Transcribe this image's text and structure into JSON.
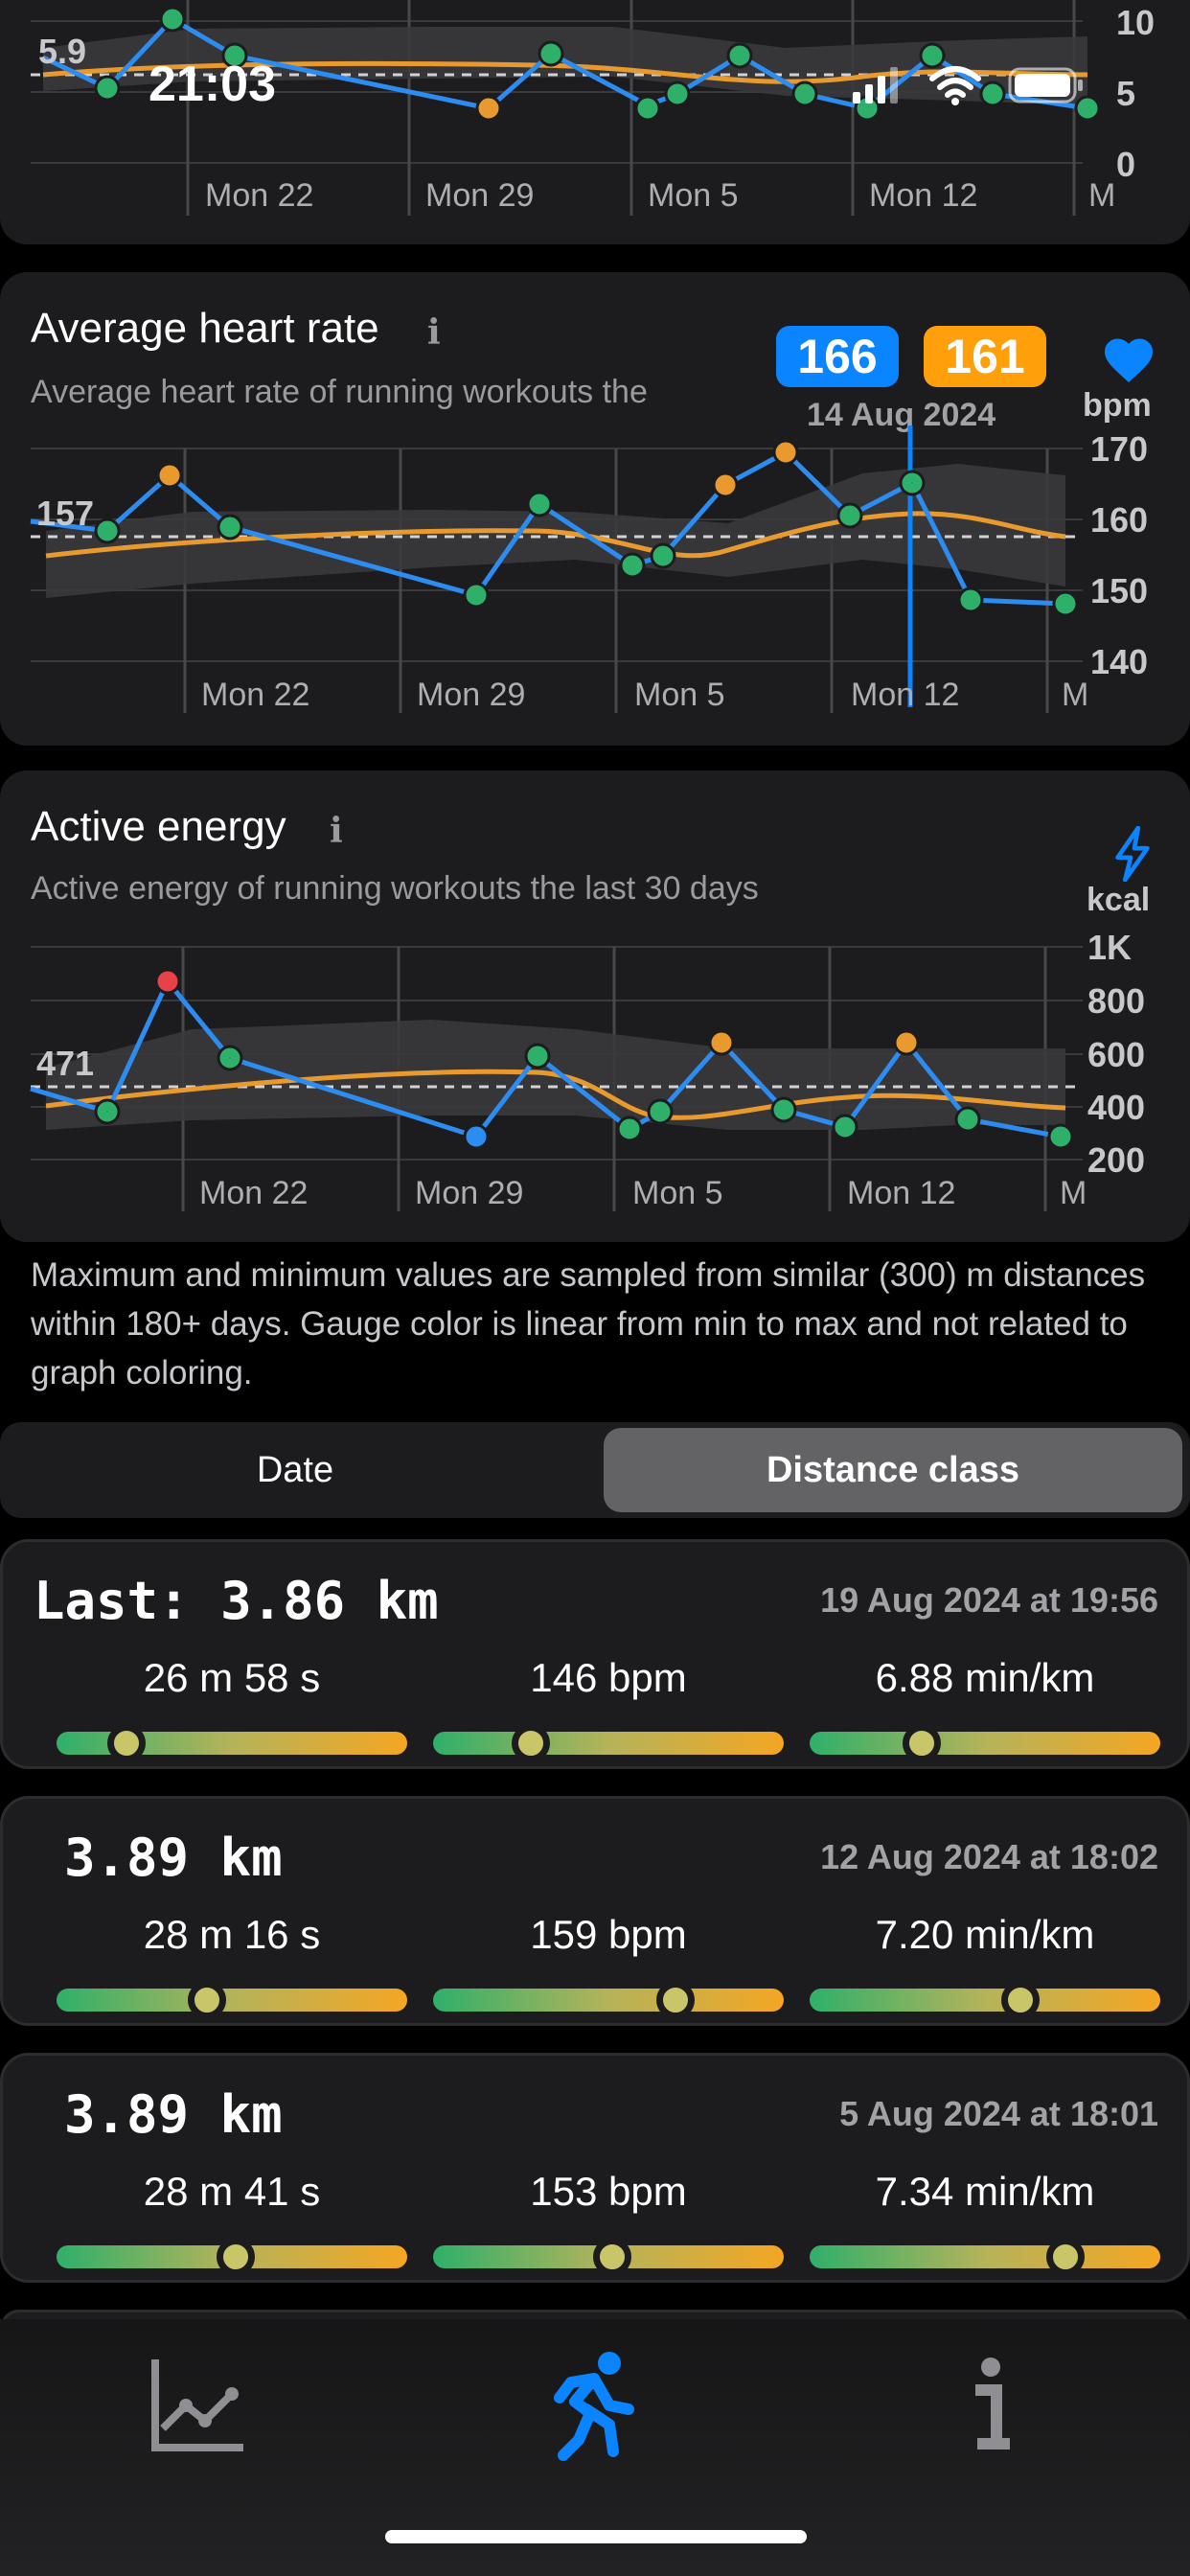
{
  "status_bar": {
    "time": "21:03"
  },
  "top_chart": {
    "avg_label": "5.9",
    "y_ticks": [
      "10",
      "5",
      "0"
    ],
    "x_ticks": [
      "Mon 22",
      "Mon 29",
      "Mon 5",
      "Mon 12",
      "M"
    ]
  },
  "heart_rate": {
    "title": "Average heart rate",
    "info": "i",
    "subtitle": "Average heart rate of running workouts the",
    "badge_current": "166",
    "badge_compare": "161",
    "selected_date": "14 Aug 2024",
    "unit": "bpm",
    "avg_label": "157",
    "y_ticks": [
      "170",
      "160",
      "150",
      "140"
    ],
    "x_ticks": [
      "Mon 22",
      "Mon 29",
      "Mon 5",
      "Mon 12",
      "M"
    ],
    "colors": {
      "current": "#0a84ff",
      "compare": "#ff9f0a",
      "heart": "#0a84ff"
    }
  },
  "active_energy": {
    "title": "Active energy",
    "info": "i",
    "subtitle": "Active energy of running workouts the last 30 days",
    "unit": "kcal",
    "avg_label": "471",
    "y_ticks": [
      "1K",
      "800",
      "600",
      "400",
      "200"
    ],
    "x_ticks": [
      "Mon 22",
      "Mon 29",
      "Mon 5",
      "Mon 12",
      "M"
    ]
  },
  "note": "Maximum and minimum values are sampled from similar (300) m distances within 180+ days. Gauge color is linear from min to max and not related to graph coloring.",
  "segmented": {
    "options": [
      "Date",
      "Distance class"
    ],
    "selected": "Distance class"
  },
  "workouts": [
    {
      "title": "Last: 3.86 km",
      "date": "19 Aug 2024 at 19:56",
      "time": "26 m 58 s",
      "hr": "146 bpm",
      "pace": "6.88 min/km",
      "time_level": 0.2,
      "hr_level": 0.28,
      "pace_level": 0.32
    },
    {
      "title": "3.89 km",
      "date": "12 Aug 2024 at 18:02",
      "time": "28 m 16 s",
      "hr": "159 bpm",
      "pace": "7.20 min/km",
      "time_level": 0.43,
      "hr_level": 0.69,
      "pace_level": 0.6
    },
    {
      "title": "3.89 km",
      "date": "5 Aug 2024 at 18:01",
      "time": "28 m 41 s",
      "hr": "153 bpm",
      "pace": "7.34 min/km",
      "time_level": 0.51,
      "hr_level": 0.51,
      "pace_level": 0.73
    }
  ],
  "tab_bar": {
    "items": [
      "chart-icon",
      "running-icon",
      "info-icon"
    ],
    "selected": "running-icon",
    "accent": "#0a84ff"
  }
}
